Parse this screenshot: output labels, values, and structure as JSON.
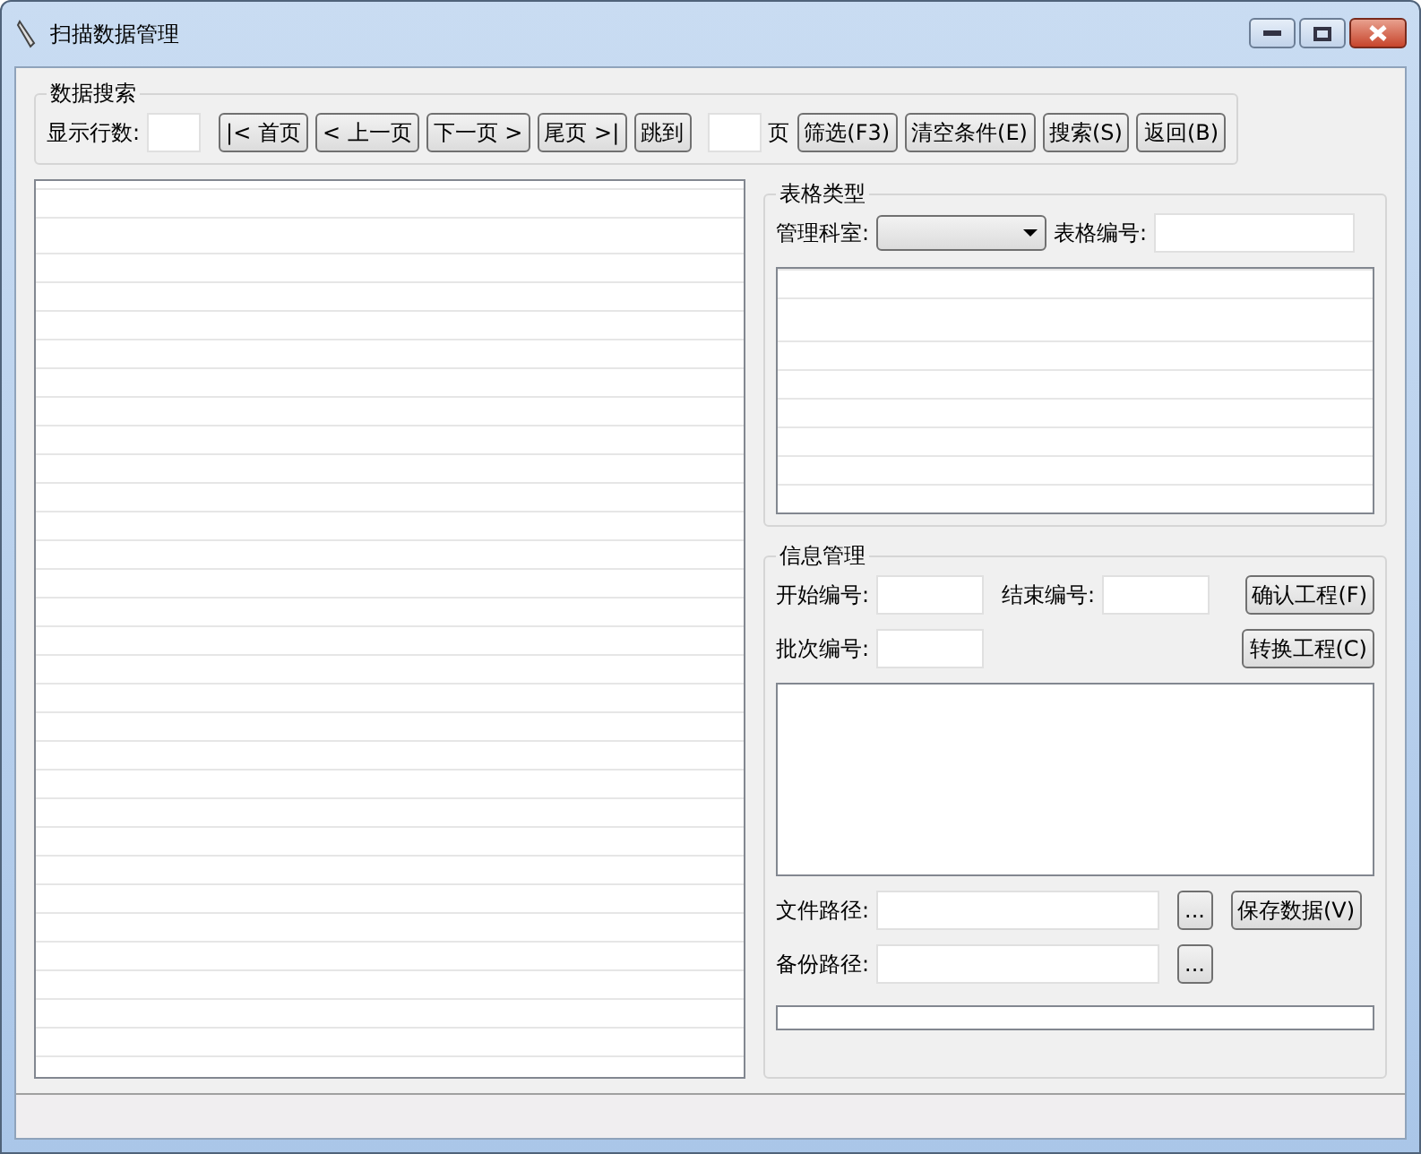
{
  "window": {
    "title": "扫描数据管理"
  },
  "search_group": {
    "title": "数据搜索",
    "rows_label": "显示行数:",
    "buttons": [
      "|< 首页",
      "< 上一页",
      "下一页 >",
      "尾页 >|",
      "跳到"
    ],
    "page_label": "页",
    "actions": [
      "筛选(F3)",
      "清空条件(E)",
      "搜索(S)",
      "返回(B)"
    ]
  },
  "form_type": {
    "title": "表格类型",
    "dept_label": "管理科室:",
    "number_label": "表格编号:"
  },
  "info": {
    "title": "信息管理",
    "start_label": "开始编号:",
    "end_label": "结束编号:",
    "confirm_button": "确认工程(F)",
    "batch_label": "批次编号:",
    "convert_button": "转换工程(C)",
    "file_label": "文件路径:",
    "browse_button": "...",
    "save_button": "保存数据(V)",
    "backup_label": "备份路径:",
    "backup_browse_button": "...",
    "progress": {
      "level": 0
    }
  }
}
